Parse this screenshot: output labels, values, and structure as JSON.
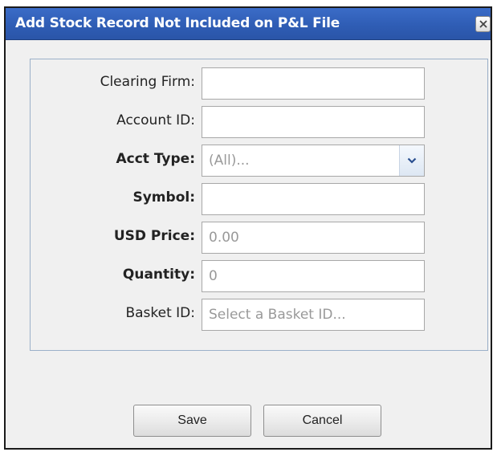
{
  "dialog": {
    "title": "Add Stock Record Not Included on P&L File",
    "close_icon": "close-icon"
  },
  "form": {
    "clearing_firm": {
      "label": "Clearing Firm:",
      "value": "",
      "placeholder": ""
    },
    "account_id": {
      "label": "Account ID:",
      "value": "",
      "placeholder": ""
    },
    "acct_type": {
      "label": "Acct Type:",
      "selected": "(All)..."
    },
    "symbol": {
      "label": "Symbol:",
      "value": "",
      "placeholder": ""
    },
    "usd_price": {
      "label": "USD Price:",
      "value": "",
      "placeholder": "0.00"
    },
    "quantity": {
      "label": "Quantity:",
      "value": "",
      "placeholder": "0"
    },
    "basket_id": {
      "label": "Basket ID:",
      "value": "",
      "placeholder": "Select a Basket ID..."
    }
  },
  "buttons": {
    "save_label": "Save",
    "cancel_label": "Cancel"
  },
  "colors": {
    "titlebar": "#2f5db5",
    "dialog_bg": "#f0f0f0",
    "fieldset_border": "#9bb0c9"
  }
}
